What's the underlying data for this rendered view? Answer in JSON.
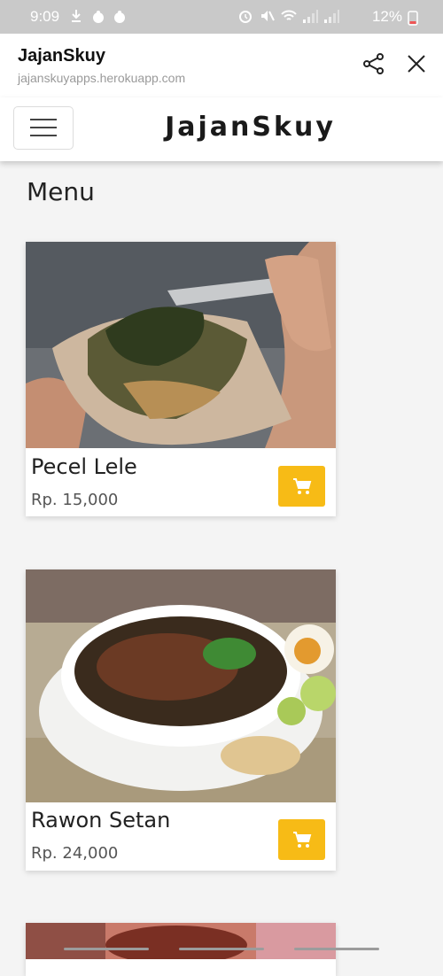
{
  "status_bar": {
    "time": "9:09",
    "battery": "12%",
    "icons": [
      "download-icon",
      "nbc-icon",
      "nbc-icon",
      "alarm-icon",
      "mute-icon",
      "wifi-icon",
      "signal-icon",
      "signal-icon",
      "battery-icon"
    ]
  },
  "browser": {
    "title": "JajanSkuy",
    "url": "jajanskuyapps.herokuapp.com",
    "actions": [
      "share-icon",
      "close-icon"
    ]
  },
  "navbar": {
    "brand": "JajanSkuy",
    "menu_icon": "hamburger-icon"
  },
  "page": {
    "heading": "Menu"
  },
  "items": [
    {
      "name": "Pecel Lele",
      "price": "Rp. 15,000",
      "cart_icon": "cart-icon"
    },
    {
      "name": "Rawon Setan",
      "price": "Rp. 24,000",
      "cart_icon": "cart-icon"
    }
  ],
  "colors": {
    "accent": "#f7bb16",
    "status_bar": "#c9c9c9",
    "background": "#f4f4f4"
  }
}
